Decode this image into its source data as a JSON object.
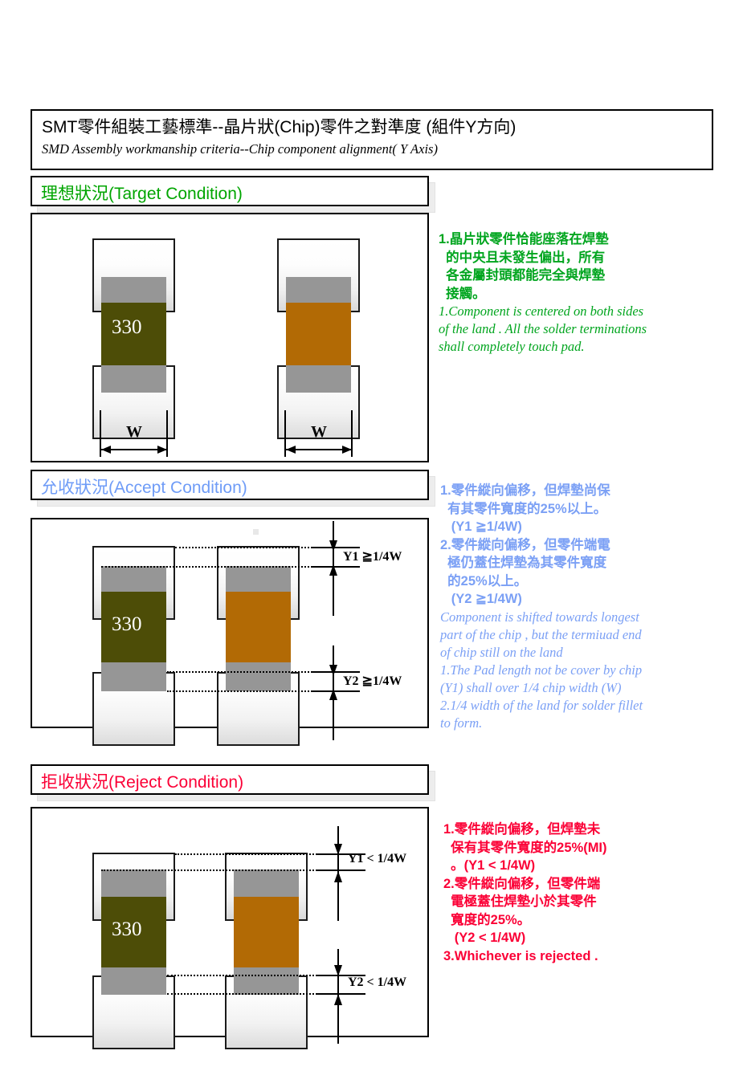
{
  "title": {
    "cn": "SMT零件組裝工藝標準--晶片狀(Chip)零件之對準度 (組件Y方向)",
    "en": "SMD Assembly workmanship criteria--Chip component alignment( Y Axis)"
  },
  "sections": {
    "target": {
      "heading": "理想狀況(Target Condition)",
      "color": "#00a500"
    },
    "accept": {
      "heading": "允收狀況(Accept Condition)",
      "color": "#6f9cf7"
    },
    "reject": {
      "heading": "拒收狀況(Reject Condition)",
      "color": "#fb0036"
    }
  },
  "component": {
    "label": "330",
    "body_olive_color": "#4d4d07",
    "body_orange_color": "#b26a05",
    "termination_color": "#969696"
  },
  "dimensions": {
    "w_left": "W",
    "w_right": "W",
    "accept_y1": "Y1 ≧1/4W",
    "accept_y2": "Y2 ≧1/4W",
    "reject_y1": "Y1 < 1/4W",
    "reject_y2": "Y2 < 1/4W"
  },
  "notes": {
    "target": {
      "cn": "1.晶片狀零件恰能座落在焊墊\n  的中央且未發生偏出，所有\n  各金屬封頭都能完全與焊墊\n  接觸。",
      "en": "1.Component is centered on both sides\nof the land . All the solder terminations\nshall completely touch pad."
    },
    "accept": {
      "cn": "1.零件縱向偏移，但焊墊尚保\n  有其零件寬度的25%以上。\n   (Y1 ≧1/4W)\n2.零件縱向偏移，但零件端電\n  極仍蓋住焊墊為其零件寬度\n  的25%以上。\n   (Y2 ≧1/4W)",
      "en": "Component is shifted towards longest\npart of the chip , but the termiuad end\nof chip still on the land\n1.The Pad length not be cover by chip\n(Y1) shall over 1/4 chip width (W)\n2.1/4 width of the land for solder fillet\nto form."
    },
    "reject": {
      "cn": "1.零件縱向偏移，但焊墊未\n  保有其零件寬度的25%(MI)\n  。(Y1 < 1/4W)\n2.零件縱向偏移，但零件端\n  電極蓋住焊墊小於其零件\n  寬度的25%。\n   (Y2 < 1/4W)\n3.Whichever is rejected ."
    }
  }
}
